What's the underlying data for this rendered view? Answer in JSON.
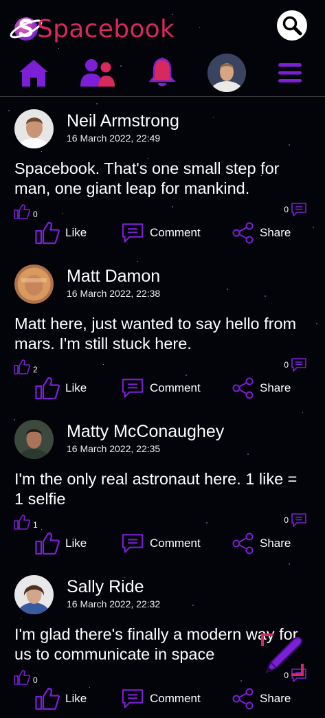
{
  "app": {
    "brand_name": "Spacebook",
    "accent_color": "#7d1fd6",
    "brand_color": "#d9285c"
  },
  "header": {
    "search_icon": "search-icon",
    "nav": [
      {
        "icon": "home-icon"
      },
      {
        "icon": "friends-icon"
      },
      {
        "icon": "bell-icon"
      },
      {
        "icon": "profile-avatar"
      },
      {
        "icon": "menu-icon"
      }
    ]
  },
  "actions": {
    "like_label": "Like",
    "comment_label": "Comment",
    "share_label": "Share"
  },
  "posts": [
    {
      "author": "Neil Armstrong",
      "time": "16 March 2022, 22:49",
      "text": "Spacebook. That's one small step for man, one giant leap for mankind.",
      "likes": "0",
      "comments": "0"
    },
    {
      "author": "Matt Damon",
      "time": "16 March 2022, 22:38",
      "text": "Matt here, just wanted to say hello from mars. I'm still stuck here.",
      "likes": "2",
      "comments": "0"
    },
    {
      "author": "Matty McConaughey",
      "time": "16 March 2022, 22:35",
      "text": "I'm the only real astronaut here. 1 like = 1 selfie",
      "likes": "1",
      "comments": "0"
    },
    {
      "author": "Sally Ride",
      "time": "16 March 2022, 22:32",
      "text": "I'm glad there's finally a modern way for us to communicate in space",
      "likes": "0",
      "comments": "0"
    }
  ]
}
